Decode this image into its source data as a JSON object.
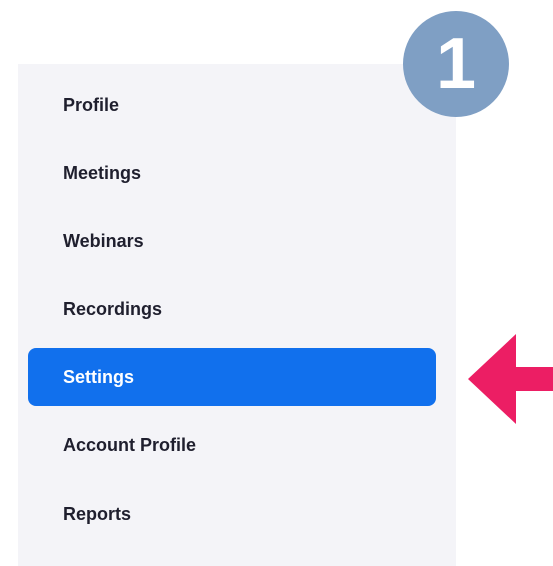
{
  "step_badge": {
    "number": "1",
    "color": "#7f9fc4"
  },
  "sidebar": {
    "background": "#f4f4f8",
    "active_color": "#1170ed",
    "items": [
      {
        "label": "Profile",
        "active": false
      },
      {
        "label": "Meetings",
        "active": false
      },
      {
        "label": "Webinars",
        "active": false
      },
      {
        "label": "Recordings",
        "active": false
      },
      {
        "label": "Settings",
        "active": true
      },
      {
        "label": "Account Profile",
        "active": false
      },
      {
        "label": "Reports",
        "active": false
      }
    ]
  },
  "pointer_arrow": {
    "icon": "left-arrow-icon",
    "color": "#ec1e64"
  }
}
